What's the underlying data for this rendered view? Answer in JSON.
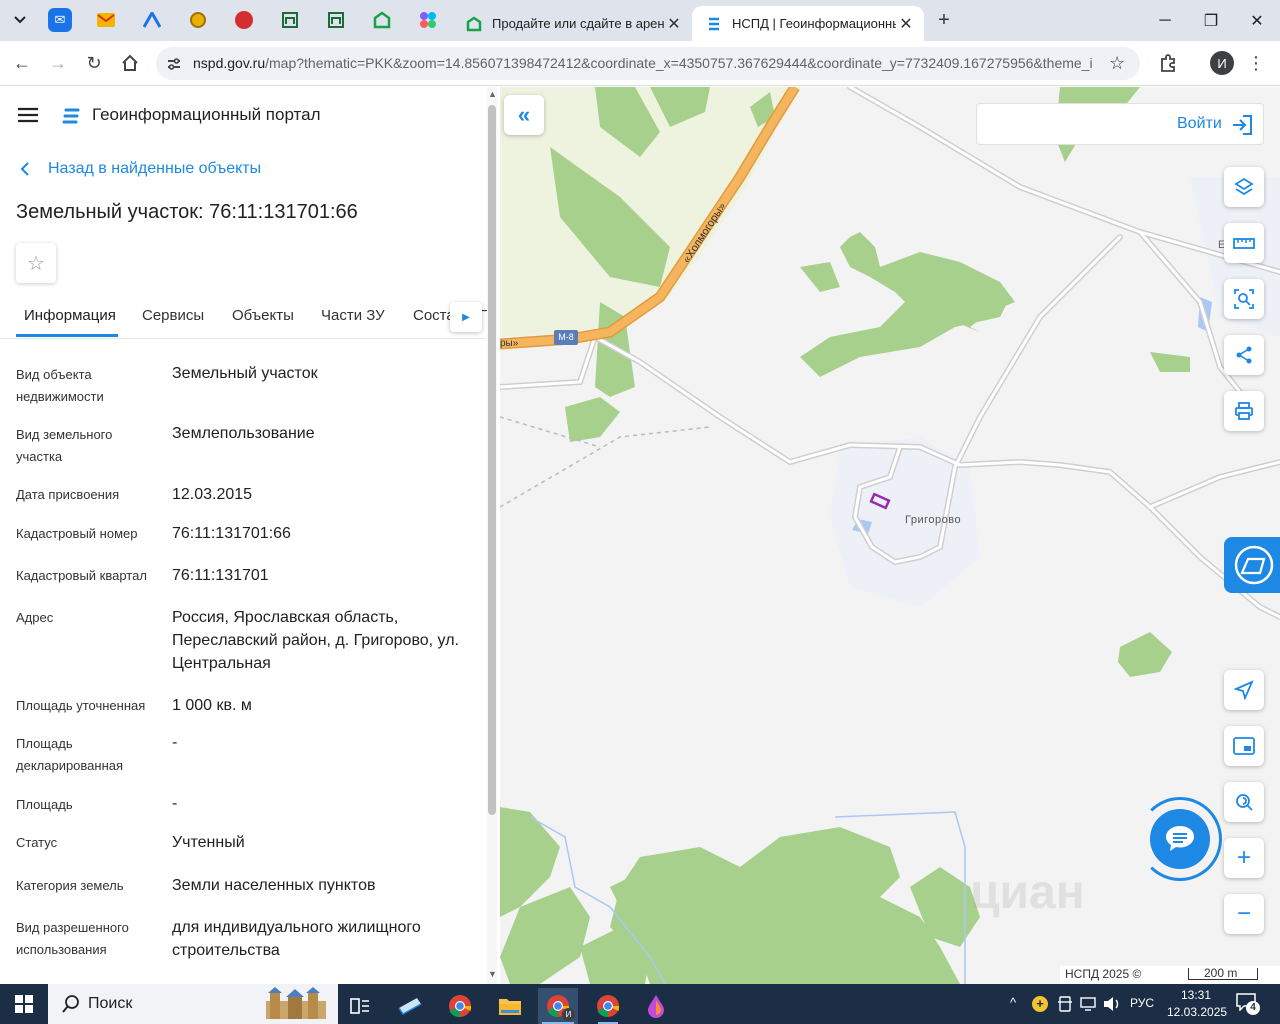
{
  "browser": {
    "tabs": [
      {
        "title": "Продайте или сдайте в аренду"
      },
      {
        "title": "НСПД | Геоинформационный"
      }
    ],
    "url_main": "nspd.gov.ru",
    "url_rest": "/map?thematic=PKK&zoom=14.856071398472412&coordinate_x=4350757.367629444&coordinate_y=7732409.167275956&theme_i...",
    "profile_initial": "И"
  },
  "panel": {
    "portal_title": "Геоинформационный портал",
    "back_link": "Назад в найденные объекты",
    "object_title": "Земельный участок: 76:11:131701:66",
    "tabs": [
      "Информация",
      "Сервисы",
      "Объекты",
      "Части ЗУ",
      "Соста"
    ],
    "tab_overflow": "Г",
    "rows": [
      {
        "label": "Вид объекта недвижимости",
        "value": "Земельный участок"
      },
      {
        "label": "Вид земельного участка",
        "value": "Землепользование"
      },
      {
        "label": "Дата присвоения",
        "value": "12.03.2015"
      },
      {
        "label": "Кадастровый номер",
        "value": "76:11:131701:66"
      },
      {
        "label": "Кадастровый квартал",
        "value": "76:11:131701"
      },
      {
        "label": "Адрес",
        "value": "Россия, Ярославская область, Переславский район, д. Григорово, ул. Центральная"
      },
      {
        "label": "Площадь уточненная",
        "value": "1 000 кв. м"
      },
      {
        "label": "Площадь декларированная",
        "value": "-"
      },
      {
        "label": "Площадь",
        "value": "-"
      },
      {
        "label": "Статус",
        "value": "Учтенный"
      },
      {
        "label": "Категория земель",
        "value": "Земли населенных пунктов"
      },
      {
        "label": "Вид разрешенного использования",
        "value": "для индивидуального жилищного строительства"
      }
    ]
  },
  "map": {
    "login_label": "Войти",
    "road_label": "«Холмогоры»",
    "road_label_left": "ры»",
    "highway_badge": "М-8",
    "village_label": "Григорово",
    "village_label_right": "Е     о",
    "copyright": "НСПД 2025 ©",
    "scale": "200 m",
    "watermark": "циан"
  },
  "taskbar": {
    "search_placeholder": "Поиск",
    "lang": "РУС",
    "time": "13:31",
    "date": "12.03.2025",
    "notifications": "4",
    "chrome_badge": "И"
  },
  "colors": {
    "accent": "#1e88e5",
    "forest": "#a6d08b",
    "road": "#f5b55e",
    "parcel": "#9c27b0"
  }
}
